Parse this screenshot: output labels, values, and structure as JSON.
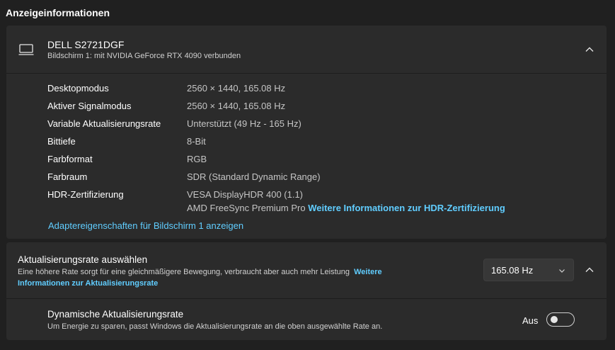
{
  "section_title": "Anzeigeinformationen",
  "monitor": {
    "name": "DELL S2721DGF",
    "subtitle": "Bildschirm 1: mit NVIDIA GeForce RTX 4090 verbunden",
    "icon": "monitor-icon",
    "expanded_icon": "chevron-up-icon"
  },
  "info_rows": [
    {
      "label": "Desktopmodus",
      "value": "2560 × 1440, 165.08 Hz"
    },
    {
      "label": "Aktiver Signalmodus",
      "value": "2560 × 1440, 165.08 Hz"
    },
    {
      "label": "Variable Aktualisierungsrate",
      "value": "Unterstützt (49 Hz - 165 Hz)"
    },
    {
      "label": "Bittiefe",
      "value": "8-Bit"
    },
    {
      "label": "Farbformat",
      "value": "RGB"
    },
    {
      "label": "Farbraum",
      "value": "SDR (Standard Dynamic Range)"
    },
    {
      "label": "HDR-Zertifizierung",
      "value": "VESA DisplayHDR 400 (1.1)",
      "value_line2": "AMD FreeSync Premium Pro",
      "link": "Weitere Informationen zur HDR-Zertifizierung"
    }
  ],
  "adapter_link": "Adaptereigenschaften für Bildschirm 1 anzeigen",
  "refresh": {
    "title": "Aktualisierungsrate auswählen",
    "description": "Eine höhere Rate sorgt für eine gleichmäßigere Bewegung, verbraucht aber auch mehr Leistung",
    "link": "Weitere Informationen zur Aktualisierungsrate",
    "selected_rate": "165.08 Hz"
  },
  "dynamic": {
    "title": "Dynamische Aktualisierungsrate",
    "subtitle": "Um Energie zu sparen, passt Windows die Aktualisierungsrate an die oben ausgewählte Rate an.",
    "toggle_label": "Aus",
    "toggle_on": false
  },
  "colors": {
    "background": "#202020",
    "card": "#2b2b2b",
    "accent_link": "#60cdff"
  }
}
